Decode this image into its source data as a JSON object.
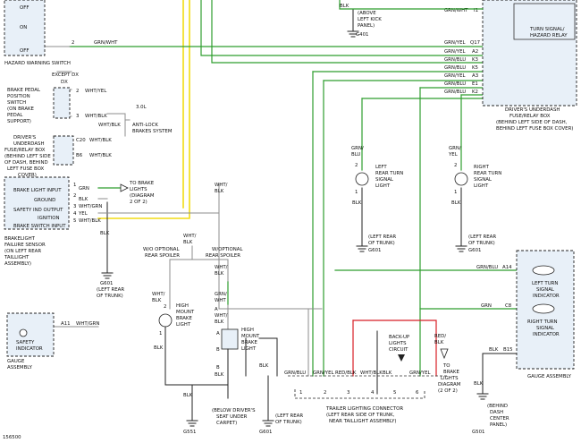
{
  "switches": {
    "hazard": {
      "name": "HAZARD WARNING SWITCH",
      "off_top": "OFF",
      "on": "ON",
      "off_bottom": "OFF",
      "pin": "2",
      "wire": "GRN/WHT"
    },
    "brake": {
      "name_lines": [
        "BRAKE PEDAL",
        "POSITION",
        "SWITCH",
        "(ON BRAKE",
        "PEDAL",
        "SUPPORT)"
      ],
      "except": "EXCEPT DX",
      "dx": "DX",
      "pin2": "2",
      "wire2": "WHT/YEL",
      "pin3": "3",
      "wire3": "WHT/BLK",
      "v30": "3.0L",
      "wire_abs": "WHT/BLK",
      "abs_lines": [
        "ANTI-LOCK",
        "BRAKES SYSTEM"
      ]
    }
  },
  "dash_box_left": {
    "name_lines": [
      "DRIVER'S",
      "UNDERDASH",
      "FUSE/RELAY BOX",
      "(BEHIND LEFT SIDE",
      "OF DASH, BEHIND",
      "LEFT FUSE BOX",
      "COVER)"
    ],
    "c20": "C20",
    "b6": "B6",
    "wire1": "WHT/BLK",
    "wire2": "WHT/BLK"
  },
  "failure_sensor": {
    "rows": [
      "BRAKE LIGHT INPUT",
      "GROUND",
      "SAFETY IND OUTPUT",
      "IGNITION",
      "BRAKE SWITCH INPUT"
    ],
    "pins": [
      "1",
      "2",
      "3",
      "4",
      "5"
    ],
    "wires": [
      "GRN",
      "BLK",
      "WHT/GRN",
      "YEL",
      "WHT/BLK"
    ],
    "name_lines": [
      "BRAKELIGHT",
      "FAILURE SENSOR",
      "(ON LEFT REAR",
      "TAILLIGHT",
      "ASSEMBLY)"
    ],
    "to_brake_lights": [
      "TO BRAKE",
      "LIGHTS",
      "(DIAGRAM",
      "2 OF 2)"
    ],
    "gnd_wire": "BLK",
    "gnd_label": "G601",
    "gnd_loc": [
      "(LEFT REAR",
      "OF TRUNK)"
    ]
  },
  "safety_indicator": {
    "label_lines": [
      "SAFETY",
      "INDICATOR"
    ],
    "pin": "A11",
    "wire": "WHT/GRN",
    "assembly": [
      "GAUGE",
      "ASSEMBLY"
    ]
  },
  "top_center": {
    "blk": "BLK",
    "kick_lines": [
      "(ABOVE",
      "LEFT KICK",
      "PANEL)"
    ],
    "g401": "G401"
  },
  "relay_box": {
    "relay_lines": [
      "TURN SIGNAL/",
      "HAZARD RELAY"
    ],
    "pins": [
      "I1",
      "Q17",
      "A2",
      "K3",
      "K5",
      "A3",
      "E1",
      "K2"
    ],
    "wires": [
      "GRN/WHT",
      "GRN/YEL",
      "GRN/YEL",
      "GRN/BLU",
      "GRN/BLU",
      "GRN/YEL",
      "GRN/BLU",
      "GRN/BLU"
    ],
    "name_lines": [
      "DRIVER'S UNDERDASH",
      "FUSE/RELAY BOX",
      "(BEHIND LEFT SIDE OF DASH,",
      "BEHIND LEFT FUSE BOX COVER)"
    ]
  },
  "left_turn": {
    "wire_top": [
      "GRN/",
      "BLU"
    ],
    "pins": [
      "2",
      "1"
    ],
    "name_lines": [
      "LEFT",
      "REAR TURN",
      "SIGNAL",
      "LIGHT"
    ],
    "wire_bot": "BLK",
    "gnd_loc": [
      "(LEFT REAR",
      "OF TRUNK)"
    ],
    "gnd": "G601"
  },
  "right_turn": {
    "wire_top": [
      "GRN/",
      "YEL"
    ],
    "pins": [
      "2",
      "1"
    ],
    "name_lines": [
      "RIGHT",
      "REAR TURN",
      "SIGNAL",
      "LIGHT"
    ],
    "wire_bot": "BLK",
    "gnd_loc": [
      "(LEFT REAR",
      "OF TRUNK)"
    ],
    "gnd": "G601"
  },
  "center": {
    "wht_blk_1": [
      "WHT/",
      "BLK"
    ],
    "wht_blk_2": [
      "WHT/",
      "BLK"
    ],
    "wo_spoiler": [
      "W/O OPTIONAL",
      "REAR SPOILER"
    ],
    "w_spoiler": [
      "W/OPTIONAL",
      "REAR SPOILER"
    ]
  },
  "high_mount_1": {
    "wire_top": [
      "WHT/",
      "BLK"
    ],
    "pins": [
      "2",
      "1"
    ],
    "name_lines": [
      "HIGH",
      "MOUNT",
      "BRAKE",
      "LIGHT"
    ],
    "wire_bot": "BLK"
  },
  "high_mount_2": {
    "wire_a": [
      "WHT/",
      "BLK"
    ],
    "wire_b": [
      "GRN/",
      "WHT"
    ],
    "pins": [
      "A",
      "A",
      "B",
      "B"
    ],
    "wire_c": [
      "WHT/",
      "BLK"
    ],
    "name_lines": [
      "HIGH",
      "MOUNT",
      "BRAKE",
      "LIGHT"
    ],
    "wire_bot": "BLK"
  },
  "ground_g551": {
    "wire": "BLK",
    "loc_lines": [
      "(BELOW DRIVER'S",
      "SEAT UNDER",
      "CARPET)"
    ],
    "label": "G551"
  },
  "ground_g601b": {
    "wire": "BLK",
    "loc_lines": [
      "(LEFT REAR",
      "OF TRUNK)"
    ],
    "label": "G601"
  },
  "connector": {
    "wires": [
      "GRN/BLU",
      "GRN/YEL",
      "RED/BLK",
      "WHT/BLK",
      "BLK",
      "GRN/YEL"
    ],
    "pins": [
      "1",
      "2",
      "3",
      "4",
      "5",
      "6"
    ],
    "wire_left": "BLK",
    "backup_lines": [
      "BACK-UP",
      "LIGHTS",
      "CIRCUIT"
    ],
    "redblk": [
      "RED/",
      "BLK"
    ],
    "to_brake": [
      "TO",
      "BRAKE",
      "LIGHTS",
      "DIAGRAM",
      "(2 OF 2)"
    ],
    "name_lines": [
      "TRAILER LIGHTING CONNECTOR",
      "(LEFT REAR SIDE OF TRUNK,",
      "NEAR TAILLIGHT ASSEMBLY)"
    ]
  },
  "gauge": {
    "a14": "A14",
    "a14_wire": "GRN/BLU",
    "c8": "C8",
    "c8_wire": "GRN",
    "left_lines": [
      "LEFT TURN",
      "SIGNAL",
      "INDICATOR"
    ],
    "right_lines": [
      "RIGHT TURN",
      "SIGNAL",
      "INDICATOR"
    ],
    "b15": "B15",
    "b15_wire": "BLK",
    "name": "GAUGE ASSEMBLY",
    "gnd_wire": "BLK",
    "gnd_loc": [
      "(BEHIND",
      "DASH",
      "CENTER",
      "PANEL)"
    ],
    "gnd": "G501"
  },
  "footer": {
    "code": "156500"
  }
}
